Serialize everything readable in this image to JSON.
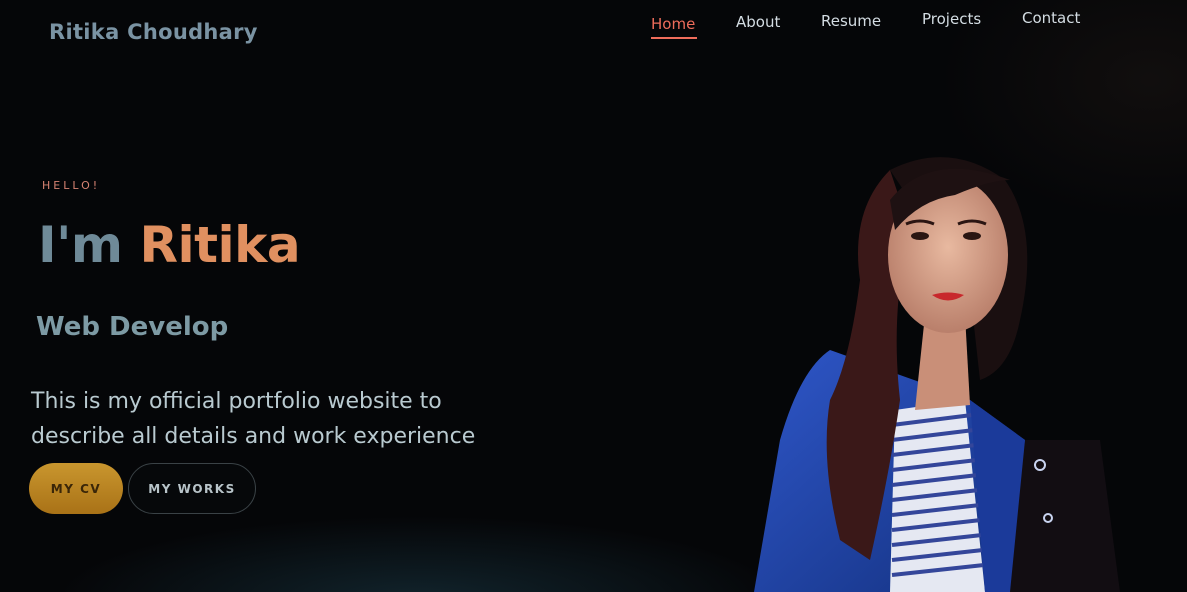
{
  "header": {
    "logo": "Ritika Choudhary",
    "nav": [
      {
        "label": "Home",
        "active": true
      },
      {
        "label": "About",
        "active": false
      },
      {
        "label": "Resume",
        "active": false
      },
      {
        "label": "Projects",
        "active": false
      },
      {
        "label": "Contact",
        "active": false
      }
    ]
  },
  "hero": {
    "greeting": "HELLO!",
    "headline_prefix": "I'm",
    "headline_name": "Ritika",
    "role": "Web Develop",
    "description": "This is my official portfolio website to describe all details and work experience",
    "buttons": {
      "cv": "MY CV",
      "works": "MY WORKS"
    }
  },
  "colors": {
    "accent": "#ef6d5b",
    "name": "#e09060",
    "button_cv": "#c9962e",
    "background": "#050608"
  }
}
